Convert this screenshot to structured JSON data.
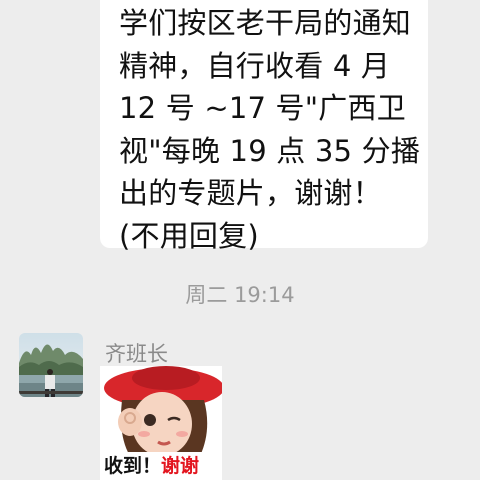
{
  "message_top": {
    "lines": [
      "学们按区老干局的通知",
      "精神，自行收看 4 月",
      "12 号 ~17 号\"广西卫",
      "视\"每晚 19 点 35 分播",
      "出的专题片，谢谢！",
      "(不用回复)"
    ]
  },
  "timestamp": "周二 19:14",
  "sender": {
    "name": "齐班长",
    "avatar_icon": "landscape-photo-avatar"
  },
  "sticker": {
    "caption_part1": "收到！",
    "caption_part2": "谢谢",
    "caption_colors": {
      "part1": "#111111",
      "part2": "#e3151f"
    },
    "icon": "cartoon-girl-red-hat-sticker"
  },
  "colors": {
    "background": "#ededed",
    "bubble": "#ffffff",
    "timestamp_text": "#9b9b9b",
    "sender_name": "#8a8a8a"
  }
}
